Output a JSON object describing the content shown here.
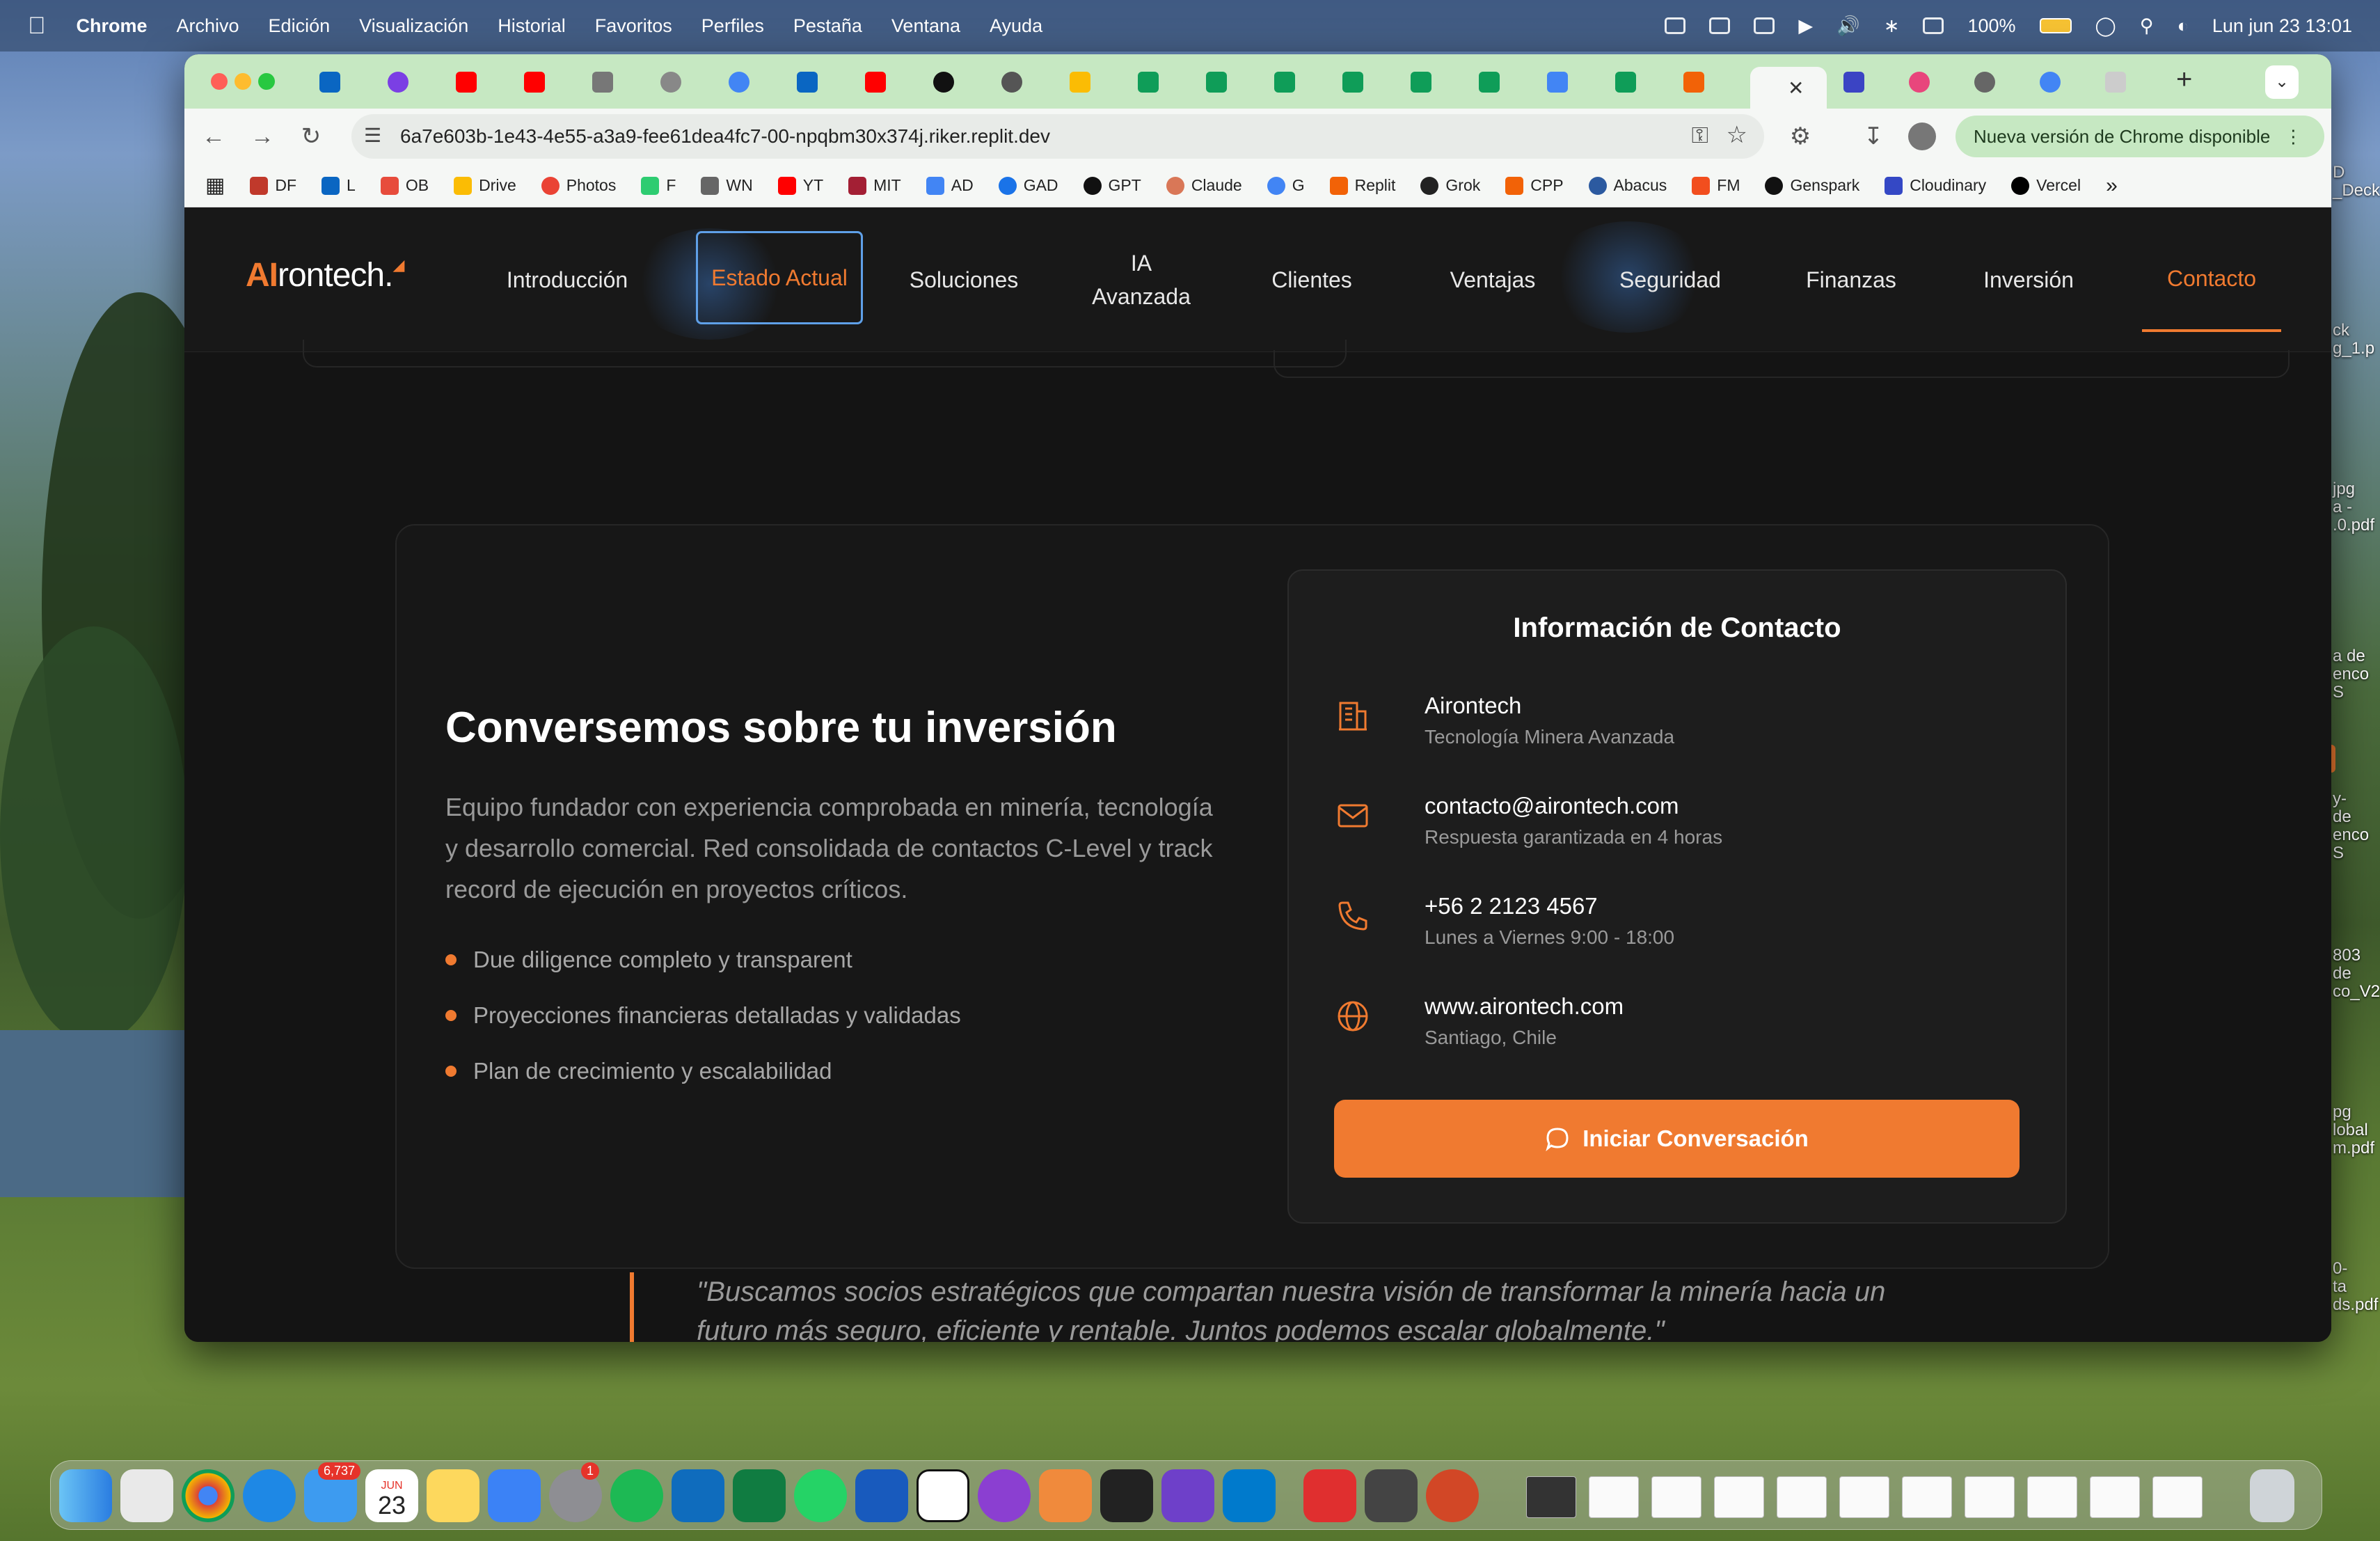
{
  "menubar": {
    "app": "Chrome",
    "items": [
      "Archivo",
      "Edición",
      "Visualización",
      "Historial",
      "Favoritos",
      "Perfiles",
      "Pestaña",
      "Ventana",
      "Ayuda"
    ],
    "battery": "100%",
    "datetime": "Lun jun 23  13:01"
  },
  "browser": {
    "url": "6a7e603b-1e43-4e55-a3a9-fee61dea4fc7-00-npqbm30x374j.riker.replit.dev",
    "update_label": "Nueva versión de Chrome disponible",
    "bookmarks": [
      "DF",
      "L",
      "OB",
      "Drive",
      "Photos",
      "F",
      "WN",
      "YT",
      "MIT",
      "AD",
      "GAD",
      "GPT",
      "Claude",
      "G",
      "Replit",
      "Grok",
      "CPP",
      "Abacus",
      "FM",
      "Genspark",
      "Cloudinary",
      "Vercel"
    ]
  },
  "site": {
    "logo_ai": "AI",
    "logo_rest": "rontech.",
    "nav": [
      "Introducción",
      "Estado Actual",
      "Soluciones",
      "IA Avanzada",
      "Clientes",
      "Ventajas",
      "Seguridad",
      "Finanzas",
      "Inversión",
      "Contacto"
    ],
    "section": {
      "title": "Conversemos sobre tu inversión",
      "description": "Equipo fundador con experiencia comprobada en minería, tecnología y desarrollo comercial. Red consolidada de contactos C-Level y track record de ejecución en proyectos críticos.",
      "bullets": [
        "Due diligence completo y transparent",
        "Proyecciones financieras detalladas y validadas",
        "Plan de crecimiento y escalabilidad"
      ]
    },
    "contact": {
      "title": "Información de Contacto",
      "rows": [
        {
          "main": "Airontech",
          "sub": "Tecnología Minera Avanzada",
          "icon": "building-icon"
        },
        {
          "main": "contacto@airontech.com",
          "sub": "Respuesta garantizada en 4 horas",
          "icon": "mail-icon"
        },
        {
          "main": "+56 2 2123 4567",
          "sub": "Lunes a Viernes 9:00 - 18:00",
          "icon": "phone-icon"
        },
        {
          "main": "www.airontech.com",
          "sub": "Santiago, Chile",
          "icon": "globe-icon"
        }
      ],
      "button": "Iniciar Conversación"
    },
    "quote": "\"Buscamos socios estratégicos que compartan nuestra visión de transformar la minería hacia un futuro más seguro, eficiente y rentable. Juntos podemos escalar globalmente.\""
  },
  "dock": {
    "mail_badge": "6,737",
    "calendar_month": "JUN",
    "calendar_day": "23",
    "settings_badge": "1"
  },
  "colors": {
    "accent": "#f07a30",
    "page_bg": "#141414",
    "focus_blue": "#5fa0e8"
  }
}
